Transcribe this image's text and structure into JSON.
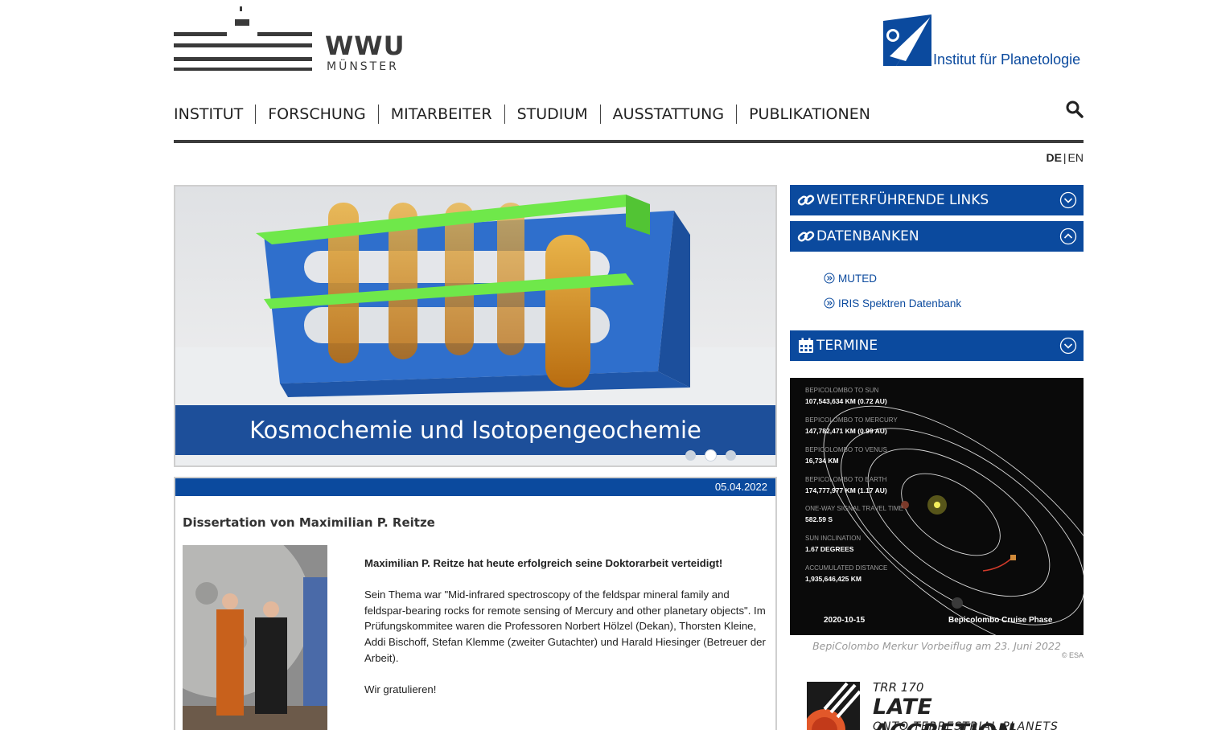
{
  "header": {
    "wwu_logo": {
      "name": "WWU",
      "sub": "MÜNSTER"
    },
    "ifp_logo": {
      "text": "Institut für Planetologie"
    }
  },
  "nav": {
    "items": [
      {
        "label": "INSTITUT"
      },
      {
        "label": "FORSCHUNG"
      },
      {
        "label": "MITARBEITER"
      },
      {
        "label": "STUDIUM"
      },
      {
        "label": "AUSSTATTUNG"
      },
      {
        "label": "PUBLIKATIONEN"
      }
    ],
    "search_icon": "search-icon"
  },
  "language": {
    "active": "DE",
    "separator": "|",
    "other": "EN"
  },
  "slider": {
    "caption": "Kosmochemie und Isotopengeochemie",
    "dot_count": 3,
    "active_dot": 2
  },
  "news": {
    "date": "05.04.2022",
    "title": "Dissertation von Maximilian P. Reitze",
    "lead": "Maximilian P. Reitze hat heute erfolgreich seine Doktorarbeit verteidigt!",
    "body": "Sein Thema war \"Mid-infrared spectroscopy of the feldspar mineral family and feldspar-bearing rocks for remote sensing of Mercury and other planetary objects\". Im Prüfungskommitee waren die Professoren Norbert Hölzel (Dekan), Thorsten Kleine, Addi Bischoff, Stefan Klemme (zweiter Gutachter) und Harald Hiesinger (Betreuer der Arbeit).",
    "closing": "Wir gratulieren!"
  },
  "sidebar": {
    "accordions": [
      {
        "label": "WEITERFÜHRENDE LINKS",
        "icon": "link-icon",
        "state": "collapsed"
      },
      {
        "label": "DATENBANKEN",
        "icon": "link-icon",
        "state": "expanded"
      },
      {
        "label": "TERMINE",
        "icon": "calendar-icon",
        "state": "collapsed"
      }
    ],
    "db_links": [
      {
        "label": "MUTED"
      },
      {
        "label": "IRIS Spektren Datenbank"
      }
    ],
    "bepi": {
      "stats": [
        {
          "label": "BEPICOLOMBO TO SUN",
          "value": "107,543,634 KM (0.72 AU)"
        },
        {
          "label": "BEPICOLOMBO TO MERCURY",
          "value": "147,782,471 KM (0.99 AU)"
        },
        {
          "label": "BEPICOLOMBO TO VENUS",
          "value": "16,734 KM"
        },
        {
          "label": "BEPICOLOMBO TO EARTH",
          "value": "174,777,977 KM (1.17 AU)"
        },
        {
          "label": "ONE-WAY SIGNAL TRAVEL TIME",
          "value": "582.59 S"
        },
        {
          "label": "SUN INCLINATION",
          "value": "1.67 DEGREES"
        },
        {
          "label": "ACCUMULATED DISTANCE",
          "value": "1,935,646,425 KM"
        }
      ],
      "date": "2020-10-15",
      "phase": "Bepicolombo Cruise Phase",
      "caption": "BepiColombo Merkur Vorbeiflug am 23. Juni 2022",
      "credit": "© ESA"
    },
    "trr": {
      "number": "TRR 170",
      "title": "LATE ACCRETION",
      "subtitle": "ONTO TERRESTRIAL PLANETS"
    }
  },
  "colors": {
    "brand_blue": "#0b4a9e",
    "caption_blue": "#1d4f9a",
    "rule_dark": "#3c3c3c"
  }
}
